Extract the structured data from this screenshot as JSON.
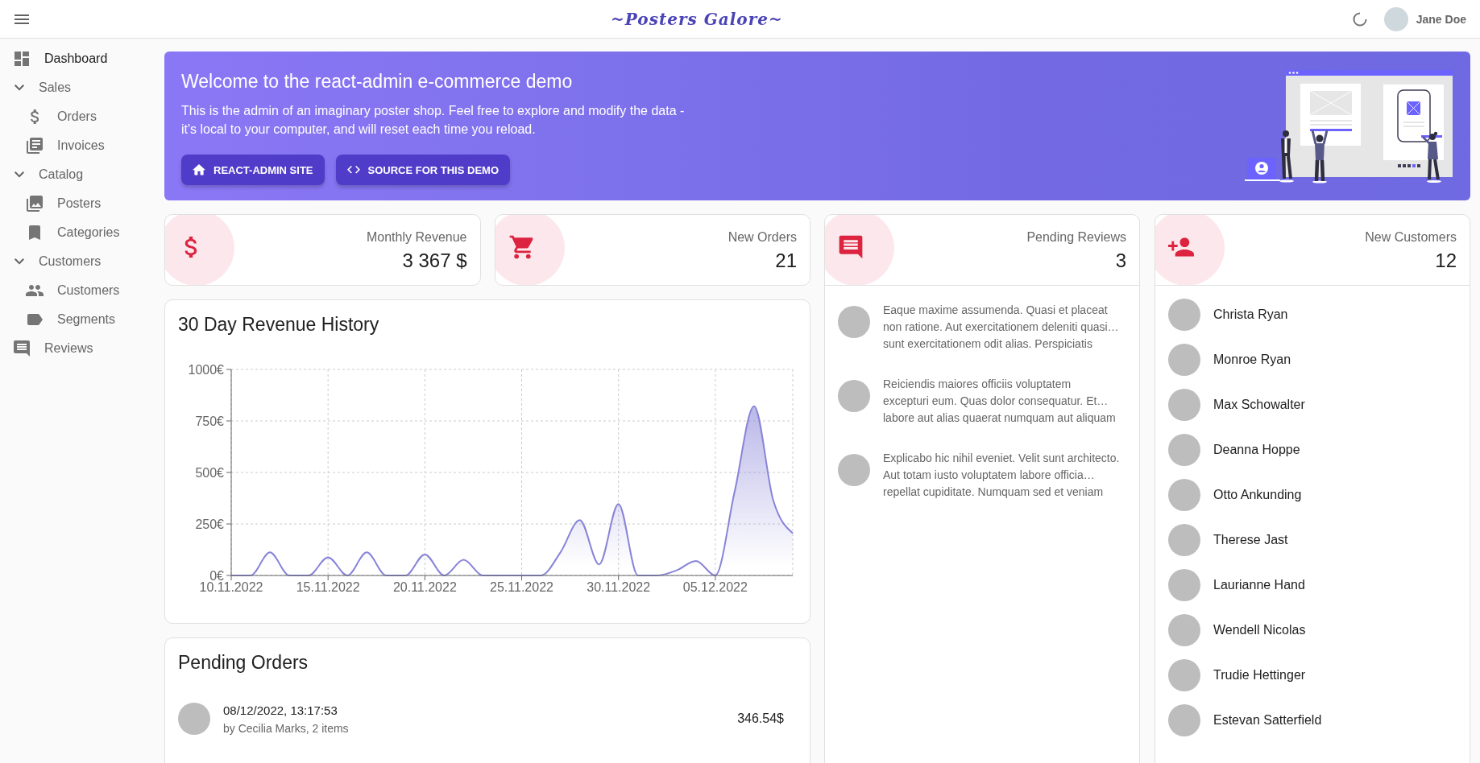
{
  "app_bar": {
    "title": "~Posters Galore~",
    "user_name": "Jane Doe"
  },
  "sidebar": {
    "items": [
      {
        "label": "Dashboard",
        "kind": "link",
        "selected": true
      },
      {
        "label": "Sales",
        "kind": "group",
        "expanded": true,
        "children": [
          {
            "label": "Orders",
            "kind": "link",
            "selected": false
          },
          {
            "label": "Invoices",
            "kind": "link",
            "selected": false
          }
        ]
      },
      {
        "label": "Catalog",
        "kind": "group",
        "expanded": true,
        "children": [
          {
            "label": "Posters",
            "kind": "link",
            "selected": false
          },
          {
            "label": "Categories",
            "kind": "link",
            "selected": false
          }
        ]
      },
      {
        "label": "Customers",
        "kind": "group",
        "expanded": true,
        "children": [
          {
            "label": "Customers",
            "kind": "link",
            "selected": false
          },
          {
            "label": "Segments",
            "kind": "link",
            "selected": false
          }
        ]
      },
      {
        "label": "Reviews",
        "kind": "link",
        "selected": false
      }
    ]
  },
  "banner": {
    "title": "Welcome to the react-admin e-commerce demo",
    "text": "This is the admin of an imaginary poster shop. Feel free to explore and modify the data - it's local to your computer, and will reset each time you reload.",
    "buttons": [
      {
        "label": "REACT-ADMIN SITE"
      },
      {
        "label": "SOURCE FOR THIS DEMO"
      }
    ]
  },
  "stats": [
    {
      "title": "Monthly Revenue",
      "value": "3 367 $"
    },
    {
      "title": "New Orders",
      "value": "21"
    }
  ],
  "revenue_history": {
    "chart_data": {
      "type": "area",
      "title": "30 Day Revenue History",
      "grid": true,
      "categories": [
        "10.11.2022",
        null,
        null,
        null,
        null,
        "15.11.2022",
        null,
        null,
        null,
        null,
        "20.11.2022",
        null,
        null,
        null,
        null,
        "25.11.2022",
        null,
        null,
        null,
        null,
        "30.11.2022",
        null,
        null,
        null,
        null,
        "05.12.2022",
        null,
        null,
        null,
        null
      ],
      "ylim": [
        0,
        1000
      ],
      "yticks": [
        {
          "value": 0,
          "label": "0€"
        },
        {
          "value": 250,
          "label": "250€"
        },
        {
          "value": 500,
          "label": "500€"
        },
        {
          "value": 750,
          "label": "750€"
        },
        {
          "value": 1000,
          "label": "1000€"
        }
      ],
      "series": [
        {
          "color": "#8884d8",
          "values": [
            0,
            0,
            112,
            0,
            0,
            88,
            0,
            112,
            0,
            0,
            102,
            0,
            76,
            0,
            0,
            0,
            0,
            112,
            269,
            54,
            347,
            0,
            0,
            25,
            70,
            0,
            408,
            821,
            362,
            205
          ]
        }
      ]
    }
  },
  "pending_orders": {
    "title": "Pending Orders",
    "orders": [
      {
        "date": "08/12/2022, 13:17:53",
        "details": "by Cecilia Marks, 2 items",
        "total": "346.54$"
      }
    ]
  },
  "pending_reviews": {
    "title": "Pending Reviews",
    "count": "3",
    "reviews": [
      {
        "text": "Eaque maxime assumenda. Quasi et placeat\nnon ratione. Aut exercitationem deleniti quasi…\nsunt exercitationem odit alias. Perspiciatis"
      },
      {
        "text": "Reiciendis maiores officiis voluptatem\nexcepturi eum. Quas dolor consequatur. Et…\nlabore aut alias quaerat numquam aut aliquam"
      },
      {
        "text": "Explicabo hic nihil eveniet. Velit sunt architecto.\nAut totam iusto voluptatem labore officia…\nrepellat cupiditate. Numquam sed et veniam"
      }
    ]
  },
  "new_customers": {
    "title": "New Customers",
    "count": "12",
    "customers": [
      {
        "name": "Christa Ryan"
      },
      {
        "name": "Monroe Ryan"
      },
      {
        "name": "Max Schowalter"
      },
      {
        "name": "Deanna Hoppe"
      },
      {
        "name": "Otto Ankunding"
      },
      {
        "name": "Therese Jast"
      },
      {
        "name": "Laurianne Hand"
      },
      {
        "name": "Wendell Nicolas"
      },
      {
        "name": "Trudie Hettinger"
      },
      {
        "name": "Estevan Satterfield"
      }
    ]
  }
}
